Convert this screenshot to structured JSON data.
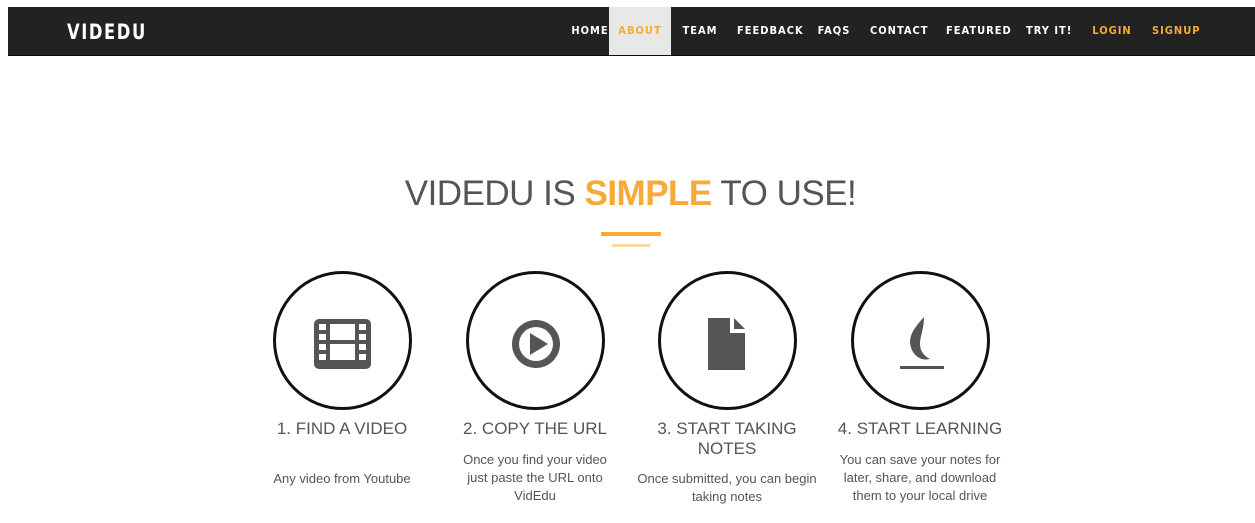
{
  "brand": "VIDEDU",
  "nav": {
    "items": [
      {
        "label": "HOME"
      },
      {
        "label": "ABOUT"
      },
      {
        "label": "TEAM"
      },
      {
        "label": "FEEDBACK"
      },
      {
        "label": "FAQS"
      },
      {
        "label": "CONTACT"
      },
      {
        "label": "FEATURED"
      },
      {
        "label": "TRY IT!"
      },
      {
        "label": "LOGIN"
      },
      {
        "label": "SIGNUP"
      }
    ],
    "active": "ABOUT"
  },
  "headline": {
    "before": "VIDEDU IS ",
    "highlight": "SIMPLE",
    "after": " TO USE!"
  },
  "colors": {
    "accent": "#f5ab35",
    "navbar": "#222222",
    "text": "#555555"
  },
  "steps": [
    {
      "title": "1. FIND A VIDEO",
      "desc": "Any video from Youtube",
      "icon": "film-icon"
    },
    {
      "title": "2. COPY THE URL",
      "desc": "Once you find your video just paste the URL onto VidEdu",
      "icon": "play-icon"
    },
    {
      "title": "3. START TAKING NOTES",
      "desc": "Once submitted, you can begin taking notes",
      "icon": "document-icon"
    },
    {
      "title": "4. START LEARNING",
      "desc": "You can save your notes for later, share, and download them to your local drive",
      "icon": "flame-icon"
    }
  ]
}
